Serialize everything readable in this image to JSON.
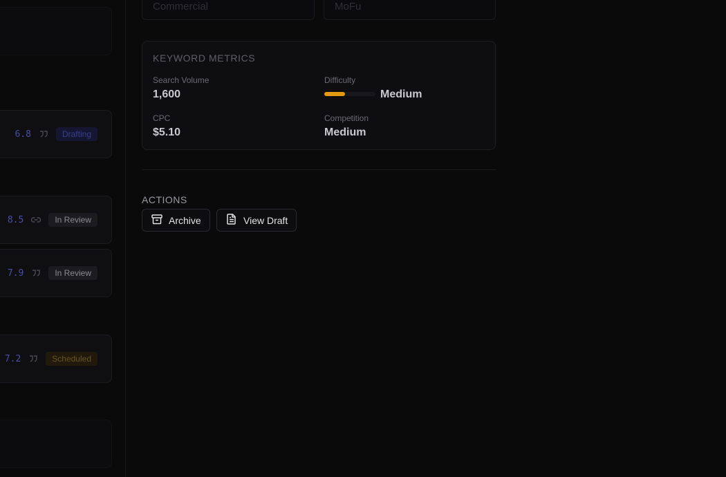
{
  "fields": {
    "intent_value": "Commercial",
    "funnel_value": "MoFu"
  },
  "list": {
    "items": [
      {
        "score": "6.8",
        "icon": "quote-icon",
        "status": "Drafting"
      },
      {
        "score": "8.5",
        "icon": "link-icon",
        "status": "In Review"
      },
      {
        "score": "7.9",
        "icon": "quote-icon",
        "status": "In Review"
      },
      {
        "score": "7.2",
        "icon": "quote-icon",
        "status": "Scheduled"
      }
    ]
  },
  "metrics": {
    "title": "KEYWORD METRICS",
    "search_volume_label": "Search Volume",
    "search_volume": "1,600",
    "difficulty_label": "Difficulty",
    "difficulty_value": "Medium",
    "difficulty_level": 0.4,
    "cpc_label": "CPC",
    "cpc": "$5.10",
    "competition_label": "Competition",
    "competition": "Medium",
    "accent_color": "#e29a10"
  },
  "actions": {
    "title": "ACTIONS",
    "archive_label": "Archive",
    "view_draft_label": "View Draft"
  }
}
